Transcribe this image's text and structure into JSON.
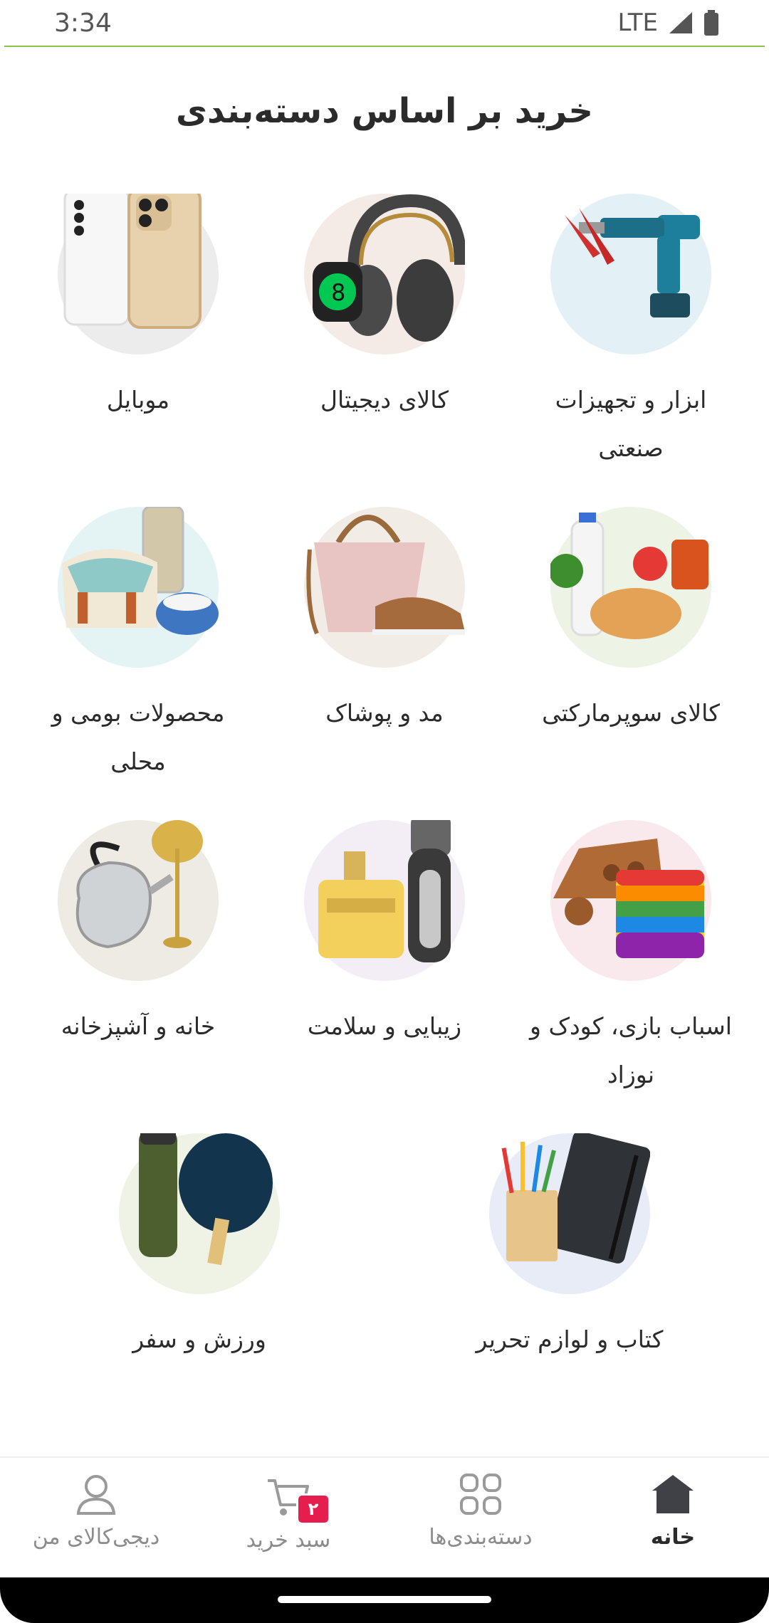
{
  "status_bar": {
    "time": "3:34",
    "network": "LTE"
  },
  "page": {
    "title": "خرید بر اساس دسته‌بندی"
  },
  "categories": [
    {
      "label": "ابزار و تجهیزات صنعتی",
      "icon": "power-drill-icon",
      "bg": "#e3f1f6"
    },
    {
      "label": "کالای دیجیتال",
      "icon": "headphones-icon",
      "bg": "#f4ebe6"
    },
    {
      "label": "موبایل",
      "icon": "smartphone-icon",
      "bg": "#ececec"
    },
    {
      "label": "کالای سوپرمارکتی",
      "icon": "groceries-icon",
      "bg": "#edf4e6"
    },
    {
      "label": "مد و پوشاک",
      "icon": "handbag-shoe-icon",
      "bg": "#f2ece6"
    },
    {
      "label": "محصولات بومی و محلی",
      "icon": "local-products-icon",
      "bg": "#e4f3f3"
    },
    {
      "label": "اسباب بازی، کودک و نوزاد",
      "icon": "toy-icon",
      "bg": "#f9e8ec"
    },
    {
      "label": "زیبایی و سلامت",
      "icon": "perfume-icon",
      "bg": "#f3edf5"
    },
    {
      "label": "خانه و آشپزخانه",
      "icon": "kettle-lamp-icon",
      "bg": "#eeebe5"
    },
    {
      "label": "کتاب و لوازم تحریر",
      "icon": "notebook-pencils-icon",
      "bg": "#e8ecf6"
    },
    {
      "label": "ورزش و سفر",
      "icon": "sport-travel-icon",
      "bg": "#eef3e6"
    }
  ],
  "bottom_nav": [
    {
      "label": "خانه",
      "icon": "home-icon",
      "active": true
    },
    {
      "label": "دسته‌بندی‌ها",
      "icon": "grid-icon",
      "active": false
    },
    {
      "label": "سبد خرید",
      "icon": "cart-icon",
      "active": false,
      "badge": "۲"
    },
    {
      "label": "دیجی‌کالای من",
      "icon": "user-icon",
      "active": false
    }
  ],
  "colors": {
    "accent": "#e61e4d",
    "status_line": "#8bc34a",
    "active_text": "#2b2b2b",
    "inactive_text": "#8c8c8c"
  }
}
